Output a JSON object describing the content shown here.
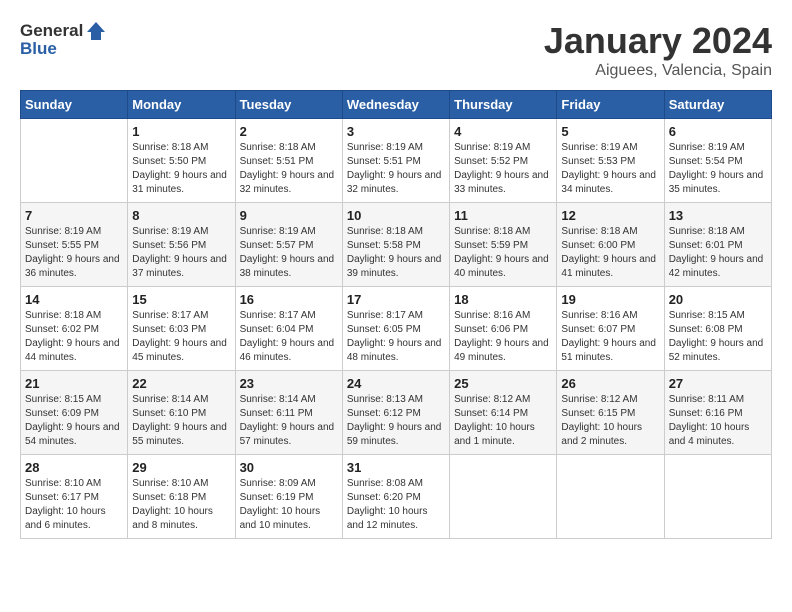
{
  "logo": {
    "general": "General",
    "blue": "Blue"
  },
  "title": "January 2024",
  "subtitle": "Aiguees, Valencia, Spain",
  "days_of_week": [
    "Sunday",
    "Monday",
    "Tuesday",
    "Wednesday",
    "Thursday",
    "Friday",
    "Saturday"
  ],
  "weeks": [
    [
      {
        "day": "",
        "sunrise": "",
        "sunset": "",
        "daylight": ""
      },
      {
        "day": "1",
        "sunrise": "Sunrise: 8:18 AM",
        "sunset": "Sunset: 5:50 PM",
        "daylight": "Daylight: 9 hours and 31 minutes."
      },
      {
        "day": "2",
        "sunrise": "Sunrise: 8:18 AM",
        "sunset": "Sunset: 5:51 PM",
        "daylight": "Daylight: 9 hours and 32 minutes."
      },
      {
        "day": "3",
        "sunrise": "Sunrise: 8:19 AM",
        "sunset": "Sunset: 5:51 PM",
        "daylight": "Daylight: 9 hours and 32 minutes."
      },
      {
        "day": "4",
        "sunrise": "Sunrise: 8:19 AM",
        "sunset": "Sunset: 5:52 PM",
        "daylight": "Daylight: 9 hours and 33 minutes."
      },
      {
        "day": "5",
        "sunrise": "Sunrise: 8:19 AM",
        "sunset": "Sunset: 5:53 PM",
        "daylight": "Daylight: 9 hours and 34 minutes."
      },
      {
        "day": "6",
        "sunrise": "Sunrise: 8:19 AM",
        "sunset": "Sunset: 5:54 PM",
        "daylight": "Daylight: 9 hours and 35 minutes."
      }
    ],
    [
      {
        "day": "7",
        "sunrise": "Sunrise: 8:19 AM",
        "sunset": "Sunset: 5:55 PM",
        "daylight": "Daylight: 9 hours and 36 minutes."
      },
      {
        "day": "8",
        "sunrise": "Sunrise: 8:19 AM",
        "sunset": "Sunset: 5:56 PM",
        "daylight": "Daylight: 9 hours and 37 minutes."
      },
      {
        "day": "9",
        "sunrise": "Sunrise: 8:19 AM",
        "sunset": "Sunset: 5:57 PM",
        "daylight": "Daylight: 9 hours and 38 minutes."
      },
      {
        "day": "10",
        "sunrise": "Sunrise: 8:18 AM",
        "sunset": "Sunset: 5:58 PM",
        "daylight": "Daylight: 9 hours and 39 minutes."
      },
      {
        "day": "11",
        "sunrise": "Sunrise: 8:18 AM",
        "sunset": "Sunset: 5:59 PM",
        "daylight": "Daylight: 9 hours and 40 minutes."
      },
      {
        "day": "12",
        "sunrise": "Sunrise: 8:18 AM",
        "sunset": "Sunset: 6:00 PM",
        "daylight": "Daylight: 9 hours and 41 minutes."
      },
      {
        "day": "13",
        "sunrise": "Sunrise: 8:18 AM",
        "sunset": "Sunset: 6:01 PM",
        "daylight": "Daylight: 9 hours and 42 minutes."
      }
    ],
    [
      {
        "day": "14",
        "sunrise": "Sunrise: 8:18 AM",
        "sunset": "Sunset: 6:02 PM",
        "daylight": "Daylight: 9 hours and 44 minutes."
      },
      {
        "day": "15",
        "sunrise": "Sunrise: 8:17 AM",
        "sunset": "Sunset: 6:03 PM",
        "daylight": "Daylight: 9 hours and 45 minutes."
      },
      {
        "day": "16",
        "sunrise": "Sunrise: 8:17 AM",
        "sunset": "Sunset: 6:04 PM",
        "daylight": "Daylight: 9 hours and 46 minutes."
      },
      {
        "day": "17",
        "sunrise": "Sunrise: 8:17 AM",
        "sunset": "Sunset: 6:05 PM",
        "daylight": "Daylight: 9 hours and 48 minutes."
      },
      {
        "day": "18",
        "sunrise": "Sunrise: 8:16 AM",
        "sunset": "Sunset: 6:06 PM",
        "daylight": "Daylight: 9 hours and 49 minutes."
      },
      {
        "day": "19",
        "sunrise": "Sunrise: 8:16 AM",
        "sunset": "Sunset: 6:07 PM",
        "daylight": "Daylight: 9 hours and 51 minutes."
      },
      {
        "day": "20",
        "sunrise": "Sunrise: 8:15 AM",
        "sunset": "Sunset: 6:08 PM",
        "daylight": "Daylight: 9 hours and 52 minutes."
      }
    ],
    [
      {
        "day": "21",
        "sunrise": "Sunrise: 8:15 AM",
        "sunset": "Sunset: 6:09 PM",
        "daylight": "Daylight: 9 hours and 54 minutes."
      },
      {
        "day": "22",
        "sunrise": "Sunrise: 8:14 AM",
        "sunset": "Sunset: 6:10 PM",
        "daylight": "Daylight: 9 hours and 55 minutes."
      },
      {
        "day": "23",
        "sunrise": "Sunrise: 8:14 AM",
        "sunset": "Sunset: 6:11 PM",
        "daylight": "Daylight: 9 hours and 57 minutes."
      },
      {
        "day": "24",
        "sunrise": "Sunrise: 8:13 AM",
        "sunset": "Sunset: 6:12 PM",
        "daylight": "Daylight: 9 hours and 59 minutes."
      },
      {
        "day": "25",
        "sunrise": "Sunrise: 8:12 AM",
        "sunset": "Sunset: 6:14 PM",
        "daylight": "Daylight: 10 hours and 1 minute."
      },
      {
        "day": "26",
        "sunrise": "Sunrise: 8:12 AM",
        "sunset": "Sunset: 6:15 PM",
        "daylight": "Daylight: 10 hours and 2 minutes."
      },
      {
        "day": "27",
        "sunrise": "Sunrise: 8:11 AM",
        "sunset": "Sunset: 6:16 PM",
        "daylight": "Daylight: 10 hours and 4 minutes."
      }
    ],
    [
      {
        "day": "28",
        "sunrise": "Sunrise: 8:10 AM",
        "sunset": "Sunset: 6:17 PM",
        "daylight": "Daylight: 10 hours and 6 minutes."
      },
      {
        "day": "29",
        "sunrise": "Sunrise: 8:10 AM",
        "sunset": "Sunset: 6:18 PM",
        "daylight": "Daylight: 10 hours and 8 minutes."
      },
      {
        "day": "30",
        "sunrise": "Sunrise: 8:09 AM",
        "sunset": "Sunset: 6:19 PM",
        "daylight": "Daylight: 10 hours and 10 minutes."
      },
      {
        "day": "31",
        "sunrise": "Sunrise: 8:08 AM",
        "sunset": "Sunset: 6:20 PM",
        "daylight": "Daylight: 10 hours and 12 minutes."
      },
      {
        "day": "",
        "sunrise": "",
        "sunset": "",
        "daylight": ""
      },
      {
        "day": "",
        "sunrise": "",
        "sunset": "",
        "daylight": ""
      },
      {
        "day": "",
        "sunrise": "",
        "sunset": "",
        "daylight": ""
      }
    ]
  ]
}
